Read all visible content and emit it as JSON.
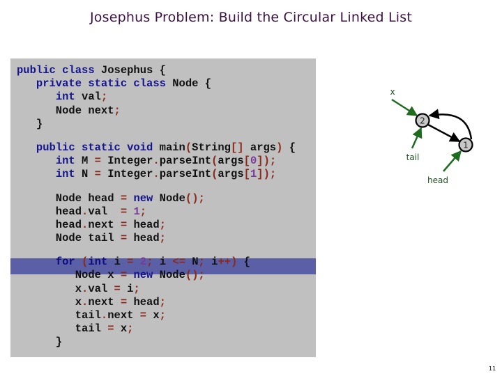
{
  "slide": {
    "title": "Josephus Problem:  Build the Circular Linked List",
    "page_number": "11"
  },
  "code": {
    "highlighted_line_index": 12,
    "lines": [
      [
        {
          "t": "public class ",
          "c": "kw"
        },
        {
          "t": "Josephus {",
          "c": ""
        }
      ],
      [
        {
          "t": "   ",
          "c": ""
        },
        {
          "t": "private static class ",
          "c": "kw"
        },
        {
          "t": "Node {",
          "c": ""
        }
      ],
      [
        {
          "t": "      ",
          "c": ""
        },
        {
          "t": "int ",
          "c": "kw"
        },
        {
          "t": "val",
          "c": ""
        },
        {
          "t": ";",
          "c": "pu"
        }
      ],
      [
        {
          "t": "      Node next",
          "c": ""
        },
        {
          "t": ";",
          "c": "pu"
        }
      ],
      [
        {
          "t": "   }",
          "c": ""
        }
      ],
      [
        {
          "t": "   ",
          "c": ""
        },
        {
          "t": "public static void ",
          "c": "kw"
        },
        {
          "t": "main",
          "c": ""
        },
        {
          "t": "(",
          "c": "pu"
        },
        {
          "t": "String",
          "c": ""
        },
        {
          "t": "[]",
          "c": "pu"
        },
        {
          "t": " args",
          "c": ""
        },
        {
          "t": ")",
          "c": "pu"
        },
        {
          "t": " {",
          "c": ""
        }
      ],
      [
        {
          "t": "      ",
          "c": ""
        },
        {
          "t": "int ",
          "c": "kw"
        },
        {
          "t": "M ",
          "c": ""
        },
        {
          "t": "=",
          "c": "pu"
        },
        {
          "t": " Integer",
          "c": ""
        },
        {
          "t": ".",
          "c": "pu"
        },
        {
          "t": "parseInt",
          "c": ""
        },
        {
          "t": "(",
          "c": "pu"
        },
        {
          "t": "args",
          "c": ""
        },
        {
          "t": "[",
          "c": "pu"
        },
        {
          "t": "0",
          "c": "num"
        },
        {
          "t": "])",
          "c": "pu"
        },
        {
          "t": ";",
          "c": "pu"
        }
      ],
      [
        {
          "t": "      ",
          "c": ""
        },
        {
          "t": "int ",
          "c": "kw"
        },
        {
          "t": "N ",
          "c": ""
        },
        {
          "t": "=",
          "c": "pu"
        },
        {
          "t": " Integer",
          "c": ""
        },
        {
          "t": ".",
          "c": "pu"
        },
        {
          "t": "parseInt",
          "c": ""
        },
        {
          "t": "(",
          "c": "pu"
        },
        {
          "t": "args",
          "c": ""
        },
        {
          "t": "[",
          "c": "pu"
        },
        {
          "t": "1",
          "c": "num"
        },
        {
          "t": "])",
          "c": "pu"
        },
        {
          "t": ";",
          "c": "pu"
        }
      ],
      [
        {
          "t": "      Node head ",
          "c": ""
        },
        {
          "t": "=",
          "c": "pu"
        },
        {
          "t": " ",
          "c": ""
        },
        {
          "t": "new ",
          "c": "kw"
        },
        {
          "t": "Node",
          "c": ""
        },
        {
          "t": "()",
          "c": "pu"
        },
        {
          "t": ";",
          "c": "pu"
        }
      ],
      [
        {
          "t": "      head",
          "c": ""
        },
        {
          "t": ".",
          "c": "pu"
        },
        {
          "t": "val  ",
          "c": ""
        },
        {
          "t": "=",
          "c": "pu"
        },
        {
          "t": " ",
          "c": ""
        },
        {
          "t": "1",
          "c": "num"
        },
        {
          "t": ";",
          "c": "pu"
        }
      ],
      [
        {
          "t": "      head",
          "c": ""
        },
        {
          "t": ".",
          "c": "pu"
        },
        {
          "t": "next ",
          "c": ""
        },
        {
          "t": "=",
          "c": "pu"
        },
        {
          "t": " head",
          "c": ""
        },
        {
          "t": ";",
          "c": "pu"
        }
      ],
      [
        {
          "t": "      Node tail ",
          "c": ""
        },
        {
          "t": "=",
          "c": "pu"
        },
        {
          "t": " head",
          "c": ""
        },
        {
          "t": ";",
          "c": "pu"
        }
      ],
      [
        {
          "t": "      ",
          "c": ""
        },
        {
          "t": "for ",
          "c": "kw"
        },
        {
          "t": "(",
          "c": "pu"
        },
        {
          "t": "int ",
          "c": "kw"
        },
        {
          "t": "i ",
          "c": ""
        },
        {
          "t": "=",
          "c": "pu"
        },
        {
          "t": " ",
          "c": ""
        },
        {
          "t": "2",
          "c": "num"
        },
        {
          "t": ";",
          "c": "pu"
        },
        {
          "t": " i ",
          "c": ""
        },
        {
          "t": "<=",
          "c": "pu"
        },
        {
          "t": " N",
          "c": ""
        },
        {
          "t": ";",
          "c": "pu"
        },
        {
          "t": " i",
          "c": ""
        },
        {
          "t": "++)",
          "c": "pu"
        },
        {
          "t": " {",
          "c": ""
        }
      ],
      [
        {
          "t": "         Node x ",
          "c": ""
        },
        {
          "t": "=",
          "c": "pu"
        },
        {
          "t": " ",
          "c": ""
        },
        {
          "t": "new ",
          "c": "kw"
        },
        {
          "t": "Node",
          "c": ""
        },
        {
          "t": "()",
          "c": "pu"
        },
        {
          "t": ";",
          "c": "pu"
        }
      ],
      [
        {
          "t": "         x",
          "c": ""
        },
        {
          "t": ".",
          "c": "pu"
        },
        {
          "t": "val ",
          "c": ""
        },
        {
          "t": "=",
          "c": "pu"
        },
        {
          "t": " i",
          "c": ""
        },
        {
          "t": ";",
          "c": "pu"
        }
      ],
      [
        {
          "t": "         x",
          "c": ""
        },
        {
          "t": ".",
          "c": "pu"
        },
        {
          "t": "next ",
          "c": ""
        },
        {
          "t": "=",
          "c": "pu"
        },
        {
          "t": " head",
          "c": ""
        },
        {
          "t": ";",
          "c": "pu"
        }
      ],
      [
        {
          "t": "         tail",
          "c": ""
        },
        {
          "t": ".",
          "c": "pu"
        },
        {
          "t": "next ",
          "c": ""
        },
        {
          "t": "=",
          "c": "pu"
        },
        {
          "t": " x",
          "c": ""
        },
        {
          "t": ";",
          "c": "pu"
        }
      ],
      [
        {
          "t": "         tail ",
          "c": ""
        },
        {
          "t": "=",
          "c": "pu"
        },
        {
          "t": " x",
          "c": ""
        },
        {
          "t": ";",
          "c": "pu"
        }
      ],
      [
        {
          "t": "      }",
          "c": ""
        }
      ]
    ],
    "gaps_before": [
      5,
      8,
      12
    ]
  },
  "diagram": {
    "nodes": [
      {
        "id": "node-2",
        "label": "2"
      },
      {
        "id": "node-1",
        "label": "1"
      }
    ],
    "pointers": [
      {
        "label": "x",
        "target": "node-2"
      },
      {
        "label": "tail",
        "target": "node-2"
      },
      {
        "label": "head",
        "target": "node-1"
      }
    ],
    "links": [
      {
        "from": "node-2",
        "to": "node-1",
        "kind": "straight"
      },
      {
        "from": "node-1",
        "to": "node-2",
        "kind": "curved"
      }
    ],
    "colors": {
      "node_fill": "#c8c8c8",
      "node_stroke": "#000000",
      "link": "#000000",
      "pointer": "#1f6b1f",
      "pointer_label": "#1f4f1f"
    }
  }
}
